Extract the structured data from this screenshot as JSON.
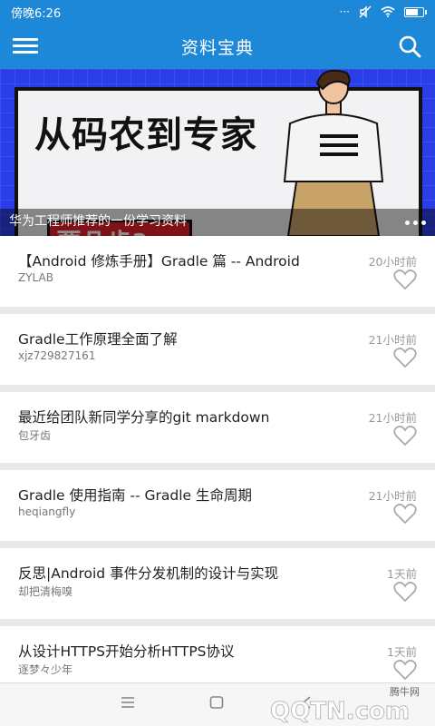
{
  "status_bar": {
    "time": "傍晚6:26",
    "signal_icon": "dots-signal-icon",
    "mute_icon": "mute-icon",
    "wifi_icon": "wifi-icon",
    "battery_icon": "battery-icon",
    "battery_level": 0.75
  },
  "app_bar": {
    "title": "资料宝典",
    "menu_icon": "hamburger-menu-icon",
    "search_icon": "search-icon",
    "color": "#1e88d8"
  },
  "banner": {
    "headline": "从码农到专家",
    "tag": "要几步?",
    "caption": "华为工程师推荐的一份学习资料"
  },
  "articles": [
    {
      "title": "【Android 修炼手册】Gradle 篇 -- Android",
      "author": "ZYLAB",
      "time": "20小时前"
    },
    {
      "title": "Gradle工作原理全面了解",
      "author": "xjz729827161",
      "time": "21小时前"
    },
    {
      "title": "最近给团队新同学分享的git markdown",
      "author": "包牙齿",
      "time": "21小时前"
    },
    {
      "title": "Gradle 使用指南 -- Gradle 生命周期",
      "author": "heqiangfly",
      "time": "21小时前"
    },
    {
      "title": "反思|Android 事件分发机制的设计与实现",
      "author": "却把清梅嗅",
      "time": "1天前"
    },
    {
      "title": "从设计HTTPS开始分析HTTPS协议",
      "author": "逐梦々少年",
      "time": "1天前"
    }
  ],
  "nav_bar": {
    "menu_icon": "menu-lines-icon",
    "home_icon": "home-square-icon",
    "back_icon": "back-icon"
  },
  "watermark": {
    "text": "腾牛网",
    "logo": "QQTN.com"
  }
}
